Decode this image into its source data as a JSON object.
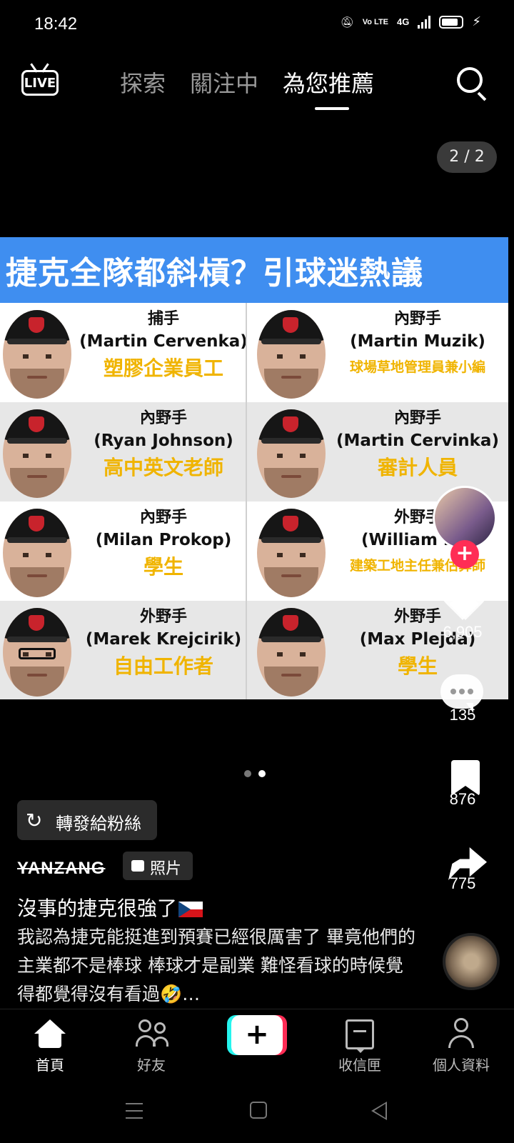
{
  "status_bar": {
    "time": "18:42",
    "icons": [
      "mute-icon",
      "volte-icon",
      "4g-signal-icon",
      "signal-icon",
      "battery-icon",
      "charging-icon"
    ],
    "volte_text": "Vo LTE",
    "network_text": "4G"
  },
  "top_nav": {
    "live_label": "LIVE",
    "tabs": [
      {
        "label": "探索",
        "active": false
      },
      {
        "label": "關注中",
        "active": false
      },
      {
        "label": "為您推薦",
        "active": true
      }
    ]
  },
  "post": {
    "pager": "2 / 2",
    "image": {
      "title": "捷克全隊都斜槓？引球迷熱議",
      "players": [
        {
          "position": "捕手",
          "name": "(Martin Cervenka)",
          "job": "塑膠企業員工"
        },
        {
          "position": "內野手",
          "name": "(Martin Muzik)",
          "job": "球場草地管理員兼小編"
        },
        {
          "position": "內野手",
          "name": "(Ryan Johnson)",
          "job": "高中英文老師"
        },
        {
          "position": "內野手",
          "name": "(Martin Cervinka)",
          "job": "審計人員"
        },
        {
          "position": "內野手",
          "name": "(Milan Prokop)",
          "job": "學生"
        },
        {
          "position": "外野手",
          "name": "(William Esc",
          "job": "建築工地主任兼估算師"
        },
        {
          "position": "外野手",
          "name": "(Marek Krejcirik)",
          "job": "自由工作者"
        },
        {
          "position": "外野手",
          "name": "(Max Plejda)",
          "job": "學生"
        }
      ]
    },
    "repost_label": "轉發給粉絲",
    "author": "YANZANG",
    "media_badge": "照片",
    "caption_title": "沒事的捷克很強了",
    "caption_body": "我認為捷克能挺進到預賽已經很厲害了 畢竟他們的主業都不是棒球 棒球才是副業 難怪看球的時候覺得都覺得沒有看過🤣…",
    "likes": "6,905",
    "comments": "135",
    "saves": "876",
    "shares": "775",
    "follow_symbol": "+"
  },
  "bottom_nav": {
    "items": [
      {
        "label": "首頁",
        "active": true
      },
      {
        "label": "好友",
        "active": false
      },
      {
        "label": "+",
        "active": false
      },
      {
        "label": "收信匣",
        "active": false
      },
      {
        "label": "個人資料",
        "active": false
      }
    ]
  },
  "colors": {
    "title_banner": "#3f8ef0",
    "job_text": "#f0b400",
    "follow": "#fe2c55",
    "create_left": "#25f4ee",
    "create_right": "#fe2c55"
  }
}
